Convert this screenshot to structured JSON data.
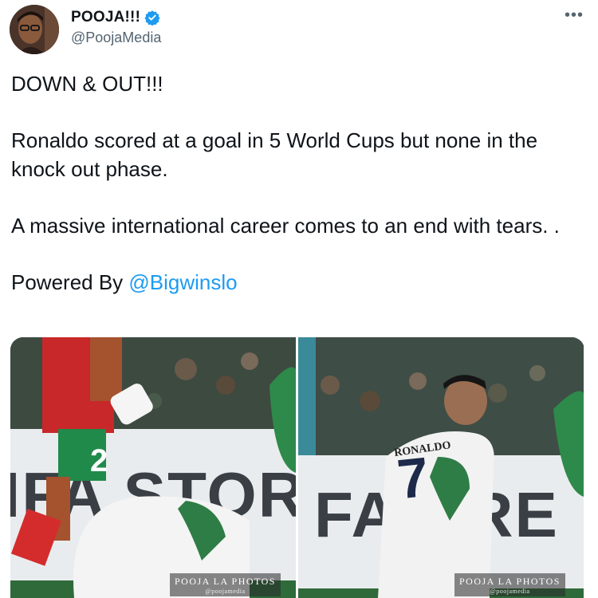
{
  "author": {
    "display_name": "POOJA!!!",
    "handle": "@PoojaMedia",
    "verified_icon": "verified-badge-icon",
    "avatar_icon": "profile-avatar"
  },
  "menu": {
    "more_label": "•••"
  },
  "tweet": {
    "line1": "DOWN & OUT!!!",
    "line2": "Ronaldo scored at a goal in 5 World Cups but none in the knock out phase.",
    "line3": "A massive international career comes to an end with tears. .",
    "powered_prefix": "Powered By ",
    "powered_mention": "@Bigwinslo"
  },
  "media": {
    "photo1": {
      "watermark_title": "POOJA LA PHOTOS",
      "watermark_sub": "@poojamedia",
      "jersey_number": "2",
      "banner_text": "IFA STORE"
    },
    "photo2": {
      "watermark_title": "POOJA LA PHOTOS",
      "watermark_sub": "@poojamedia",
      "jersey_name": "RONALDO",
      "jersey_number": "7",
      "banner_text": "FA ORE"
    }
  },
  "colors": {
    "accent": "#1d9bf0",
    "secondary_text": "#536471"
  }
}
